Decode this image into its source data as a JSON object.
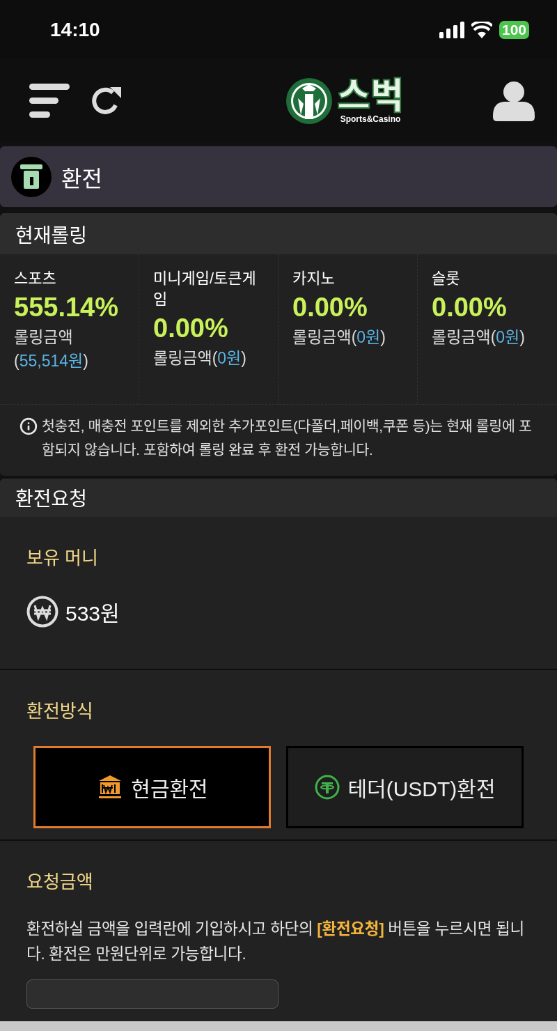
{
  "status_bar": {
    "time": "14:10",
    "battery": "100"
  },
  "header": {
    "logo_title": "스벅",
    "logo_subtitle": "Sports&Casino"
  },
  "page_title": "환전",
  "rolling": {
    "title": "현재롤링",
    "items": [
      {
        "name": "스포츠",
        "percent": "555.14%",
        "prefix": "롤링금액",
        "open": "(",
        "amount": "55,514원",
        "close": ")"
      },
      {
        "name": "미니게임/토큰게임",
        "percent": "0.00%",
        "prefix": "롤링금액",
        "open": "(",
        "amount": "0원",
        "close": ")"
      },
      {
        "name": "카지노",
        "percent": "0.00%",
        "prefix": "롤링금액",
        "open": "(",
        "amount": "0원",
        "close": ")"
      },
      {
        "name": "슬롯",
        "percent": "0.00%",
        "prefix": "롤링금액",
        "open": "(",
        "amount": "0원",
        "close": ")"
      }
    ],
    "notice": "첫충전, 매충전 포인트를 제외한 추가포인트(다폴더,페이백,쿠폰 등)는 현재 롤링에 포함되지 않습니다. 포함하여 롤링 완료 후 환전 가능합니다."
  },
  "request": {
    "title": "환전요청",
    "balance_label": "보유 머니",
    "balance": "533원",
    "method_label": "환전방식",
    "methods": [
      {
        "kind": "cash",
        "label": "현금환전",
        "selected": true
      },
      {
        "kind": "tether",
        "label": "테더(USDT)환전",
        "selected": false
      }
    ],
    "amount_label": "요청금액",
    "instructions": "환전하실 금액을 입력란에 기입하시고 하단의 **[환전요청]** 버튼을 누르시면 됩니다. 환전은 만원단위로 가능합니다."
  }
}
